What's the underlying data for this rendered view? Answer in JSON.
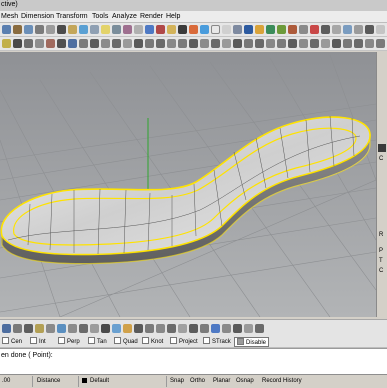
{
  "window": {
    "title": "ctive)"
  },
  "menu": [
    "Mesh",
    "Dimension",
    "Transform",
    "Tools",
    "Analyze",
    "Render",
    "Help"
  ],
  "osnap": {
    "items": [
      "Cen",
      "Int",
      "Perp",
      "Tan",
      "Quad",
      "Knot",
      "Project",
      "STrack"
    ],
    "disable_label": "Disable"
  },
  "command": {
    "prompt": "en done ( Point):"
  },
  "status": {
    "coord": ".00",
    "units": "Distance",
    "layer": "Default",
    "snap": "Snap",
    "ortho": "Ortho",
    "planar": "Planar",
    "osnap": "Osnap",
    "record": "Record History"
  },
  "side": {
    "letters": [
      "C",
      "R",
      "P",
      "T",
      "C"
    ]
  },
  "colors": {
    "viewport": "#9ea0a3",
    "highlight": "#ffe300",
    "surface": "#e2e2e2"
  }
}
